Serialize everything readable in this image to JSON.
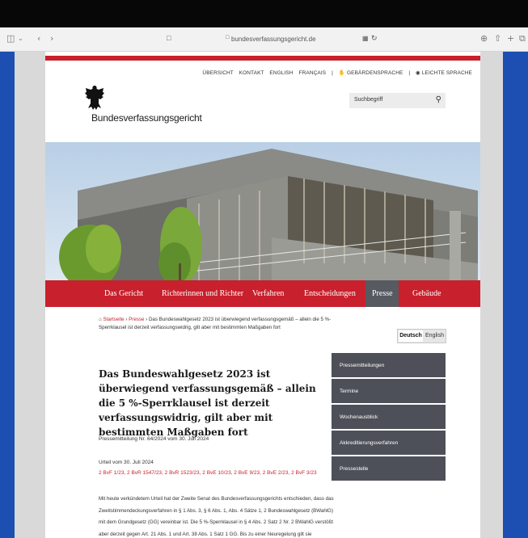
{
  "browser": {
    "url": "bundesverfassungsgericht.de",
    "icons": [
      "sidebar-icon",
      "back-icon",
      "forward-icon",
      "page-icon",
      "lock-icon",
      "extension-icon",
      "reload-icon",
      "download-icon",
      "share-icon",
      "new-tab-icon",
      "tabs-icon"
    ]
  },
  "site": {
    "service_nav": [
      "ÜBERSICHT",
      "KONTAKT",
      "ENGLISH",
      "FRANÇAIS",
      "|",
      "GEBÄRDENSPRACHE",
      "|",
      "LEICHTE SPRACHE"
    ],
    "logo_text": "Bundesverfassungsgericht",
    "search_placeholder": "Suchbegriff",
    "main_nav": [
      "Das Gericht",
      "Richterinnen und Richter",
      "Verfahren",
      "Entscheidungen",
      "Presse",
      "Gebäude"
    ],
    "main_nav_active": "Presse",
    "breadcrumb": {
      "home": "Startseite",
      "sep": "›",
      "section": "Presse",
      "current": "Das Bundeswahlgesetz 2023 ist überwiegend verfassungsgemäß – allein die 5 %-Sperrklausel ist derzeit verfassungswidrig, gilt aber mit bestimmten Maßgaben fort"
    },
    "language": {
      "de": "Deutsch",
      "en": "English"
    },
    "sidebar": [
      "Pressemitteilungen",
      "Termine",
      "Wochenausblick",
      "Akkreditierungsverfahren",
      "Pressestelle"
    ]
  },
  "article": {
    "title": "Das Bundeswahlgesetz 2023 ist überwiegend verfassungsgemäß – allein die 5 %-Sperrklausel ist derzeit verfassungswidrig, gilt aber mit bestimmten Maßgaben fort",
    "press_release": "Pressemitteilung Nr. 64/2024 vom 30. Juli 2024",
    "judgment": "Urteil vom 30. Juli 2024",
    "case_numbers": "2 BvF 1/23, 2 BvR 1547/23, 2 BvR 1523/23, 2 BvE 10/23, 2 BvE 9/23, 2 BvE 2/23, 2 BvF 3/23",
    "body": "Mit heute verkündetem Urteil hat der Zweite Senat des Bundesverfassungsgerichts entschieden, dass das Zweitstimmendeckungsverfahren in § 1 Abs. 3, § 6 Abs. 1, Abs. 4 Sätze 1, 2 Bundeswahlgesetz (BWahlG) mit dem Grundgesetz (GG) vereinbar ist. Die 5 %-Sperrklausel in § 4 Abs. 2 Satz 2 Nr. 2 BWahlG verstößt aber derzeit gegen Art. 21 Abs. 1 und Art. 38 Abs. 1 Satz 1 GG. Bis zu einer Neuregelung gilt sie"
  },
  "colors": {
    "accent_red": "#c8202c",
    "nav_gray": "#4d5058",
    "desktop_blue": "#1d4fb3"
  }
}
